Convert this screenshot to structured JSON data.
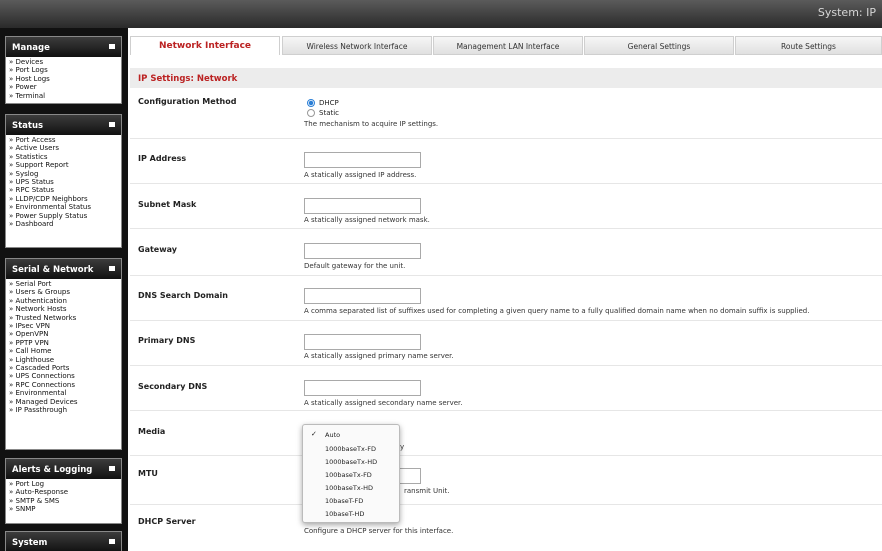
{
  "window": {
    "title": "System: IP"
  },
  "sidebar": {
    "menus": [
      {
        "title": "Manage",
        "items": [
          "» Devices",
          "» Port Logs",
          "» Host Logs",
          "» Power",
          "» Terminal"
        ]
      },
      {
        "title": "Status",
        "items": [
          "» Port Access",
          "» Active Users",
          "» Statistics",
          "» Support Report",
          "» Syslog",
          "» UPS Status",
          "» RPC Status",
          "» LLDP/CDP Neighbors",
          "» Environmental Status",
          "» Power Supply Status",
          "» Dashboard"
        ]
      },
      {
        "title": "Serial & Network",
        "items": [
          "» Serial Port",
          "» Users & Groups",
          "» Authentication",
          "» Network Hosts",
          "» Trusted Networks",
          "» IPsec VPN",
          "» OpenVPN",
          "» PPTP VPN",
          "» Call Home",
          "» Lighthouse",
          "» Cascaded Ports",
          "» UPS Connections",
          "» RPC Connections",
          "» Environmental",
          "» Managed Devices",
          "» IP Passthrough"
        ]
      },
      {
        "title": "Alerts & Logging",
        "items": [
          "» Port Log",
          "» Auto-Response",
          "» SMTP & SMS",
          "» SNMP"
        ]
      },
      {
        "title": "System",
        "items": []
      }
    ]
  },
  "tabs": [
    "Network Interface",
    "Wireless Network Interface",
    "Management LAN Interface",
    "General Settings",
    "Route Settings"
  ],
  "section": {
    "title": "IP Settings: Network"
  },
  "form": {
    "config_method": {
      "label": "Configuration Method",
      "options": [
        "DHCP",
        "Static"
      ],
      "selected": "DHCP",
      "help": "The mechanism to acquire IP settings."
    },
    "ip_address": {
      "label": "IP Address",
      "value": "",
      "help": "A statically assigned IP address."
    },
    "subnet_mask": {
      "label": "Subnet Mask",
      "value": "",
      "help": "A statically assigned network mask."
    },
    "gateway": {
      "label": "Gateway",
      "value": "",
      "help": "Default gateway for the unit."
    },
    "dns_search_domain": {
      "label": "DNS Search Domain",
      "value": "",
      "help": "A comma separated list of suffixes used for completing a given query name to a fully qualified domain name when no domain suffix is supplied."
    },
    "primary_dns": {
      "label": "Primary DNS",
      "value": "",
      "help": "A statically assigned primary name server."
    },
    "secondary_dns": {
      "label": "Secondary DNS",
      "value": "",
      "help": "A statically assigned secondary name server."
    },
    "media": {
      "label": "Media",
      "selected": "Auto",
      "help_visible": "y"
    },
    "mtu": {
      "label": "MTU",
      "value": "",
      "help_visible": "ransmit Unit."
    },
    "dhcp_server": {
      "label": "DHCP Server",
      "help": "Configure a DHCP server for this interface."
    }
  },
  "media_dropdown": {
    "options": [
      "Auto",
      "1000baseTx-FD",
      "1000baseTx-HD",
      "100baseTx-FD",
      "100baseTx-HD",
      "10baseT-FD",
      "10baseT-HD"
    ],
    "checked": "Auto",
    "check_glyph": "✓"
  },
  "colors": {
    "accent": "#bb2222",
    "radio": "#2b7fd6",
    "sidebar": "#111111"
  }
}
